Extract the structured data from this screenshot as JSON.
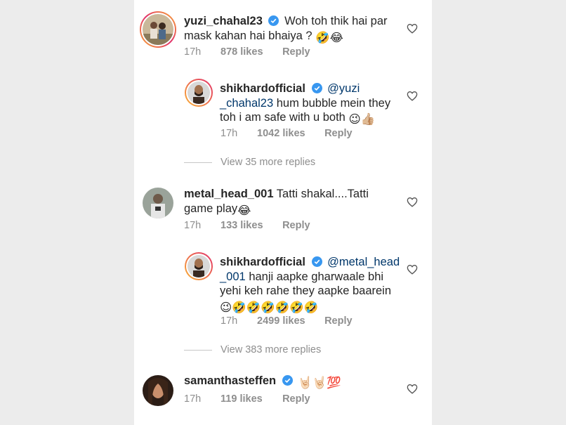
{
  "colors": {
    "accent": "#3897f0",
    "meta": "#8e8e8e",
    "mention": "#00376b"
  },
  "comments": [
    {
      "username": "yuzi_chahal23",
      "text_line1": "Woh toh thik hai par",
      "text_line2": "mask kahan hai bhaiya ?",
      "emojis": "🤣😂",
      "time": "17h",
      "likes": "878 likes",
      "reply": "Reply",
      "icon": "heart-outline-icon"
    },
    {
      "username": "shikhardofficial",
      "mention": "@yuzi",
      "mention_cont": "_chahal23",
      "text_line1": "hum bubble mein they",
      "text_line2": "toh i am safe with u both",
      "emojis": "😉👍🏼",
      "time": "17h",
      "likes": "1042 likes",
      "reply": "Reply"
    },
    {
      "view_more": "View 35 more replies"
    },
    {
      "username": "metal_head_001",
      "text_line1": "Tatti shakal....Tatti",
      "text_line2": "game play",
      "emojis": "😂",
      "time": "17h",
      "likes": "133 likes",
      "reply": "Reply"
    },
    {
      "username": "shikhardofficial",
      "mention": "@metal_head",
      "mention_cont": "_001",
      "text_line1": "hanji aapke gharwaale bhi",
      "text_line2": "yehi keh rahe they aapke baarein",
      "emojis": "😉🤣🤣🤣🤣🤣🤣",
      "time": "17h",
      "likes": "2499 likes",
      "reply": "Reply"
    },
    {
      "view_more": "View 383 more replies"
    },
    {
      "username": "samanthasteffen",
      "emojis": "🤘🏻🤘🏻💯",
      "time": "17h",
      "likes": "119 likes",
      "reply": "Reply"
    }
  ]
}
